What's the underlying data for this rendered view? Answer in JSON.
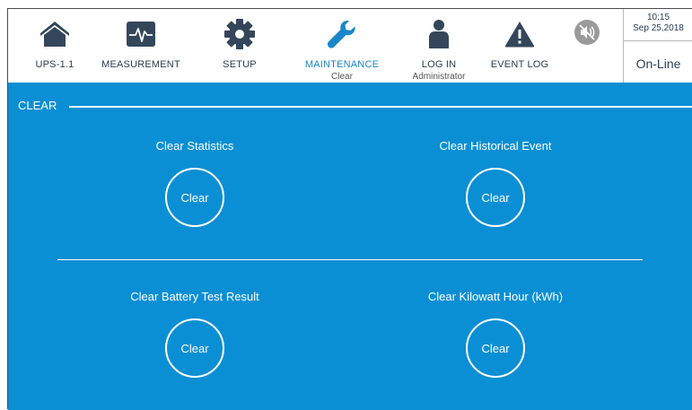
{
  "nav": {
    "items": [
      {
        "label": "UPS-1.1",
        "sub": "",
        "icon": "home-icon"
      },
      {
        "label": "MEASUREMENT",
        "sub": "",
        "icon": "pulse-icon"
      },
      {
        "label": "SETUP",
        "sub": "",
        "icon": "gear-icon"
      },
      {
        "label": "MAINTENANCE",
        "sub": "Clear",
        "icon": "wrench-icon"
      },
      {
        "label": "LOG IN",
        "sub": "Administrator",
        "icon": "user-icon"
      },
      {
        "label": "EVENT LOG",
        "sub": "",
        "icon": "warning-icon"
      }
    ],
    "mute_icon": "speaker-muted-icon"
  },
  "status": {
    "time": "10:15",
    "date": "Sep 25,2018",
    "state": "On-Line"
  },
  "section": {
    "title": "CLEAR"
  },
  "actions": [
    {
      "title": "Clear Statistics",
      "button": "Clear"
    },
    {
      "title": "Clear Historical Event",
      "button": "Clear"
    },
    {
      "title": "Clear Battery Test Result",
      "button": "Clear"
    },
    {
      "title": "Clear Kilowatt Hour (kWh)",
      "button": "Clear"
    }
  ],
  "colors": {
    "accent": "#0b8fd4",
    "nav_text": "#2b3d4f",
    "active": "#1a86c8",
    "icon": "#34465a"
  }
}
